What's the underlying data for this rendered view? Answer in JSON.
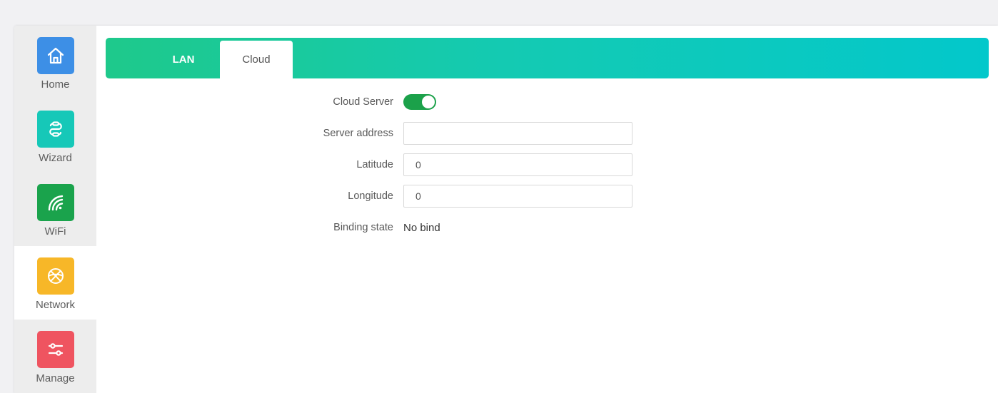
{
  "sidebar": {
    "items": [
      {
        "label": "Home",
        "icon": "home-icon",
        "color": "#3d8fe6"
      },
      {
        "label": "Wizard",
        "icon": "link-icon",
        "color": "#16c8b8"
      },
      {
        "label": "WiFi",
        "icon": "wifi-icon",
        "color": "#1aa34c"
      },
      {
        "label": "Network",
        "icon": "globe-icon",
        "color": "#f7b728"
      },
      {
        "label": "Manage",
        "icon": "sliders-icon",
        "color": "#ef5460"
      }
    ],
    "active": "Network"
  },
  "tabs": [
    {
      "label": "LAN",
      "active": false
    },
    {
      "label": "Cloud",
      "active": true
    }
  ],
  "form": {
    "cloud_server": {
      "label": "Cloud Server",
      "enabled": true
    },
    "server_address": {
      "label": "Server address",
      "value": ""
    },
    "latitude": {
      "label": "Latitude",
      "value": "0"
    },
    "longitude": {
      "label": "Longitude",
      "value": "0"
    },
    "binding_state": {
      "label": "Binding state",
      "value": "No bind"
    }
  },
  "colors": {
    "accent_green": "#1ba14a",
    "tabbar_start": "#1ec98b",
    "tabbar_end": "#03c8cb"
  }
}
